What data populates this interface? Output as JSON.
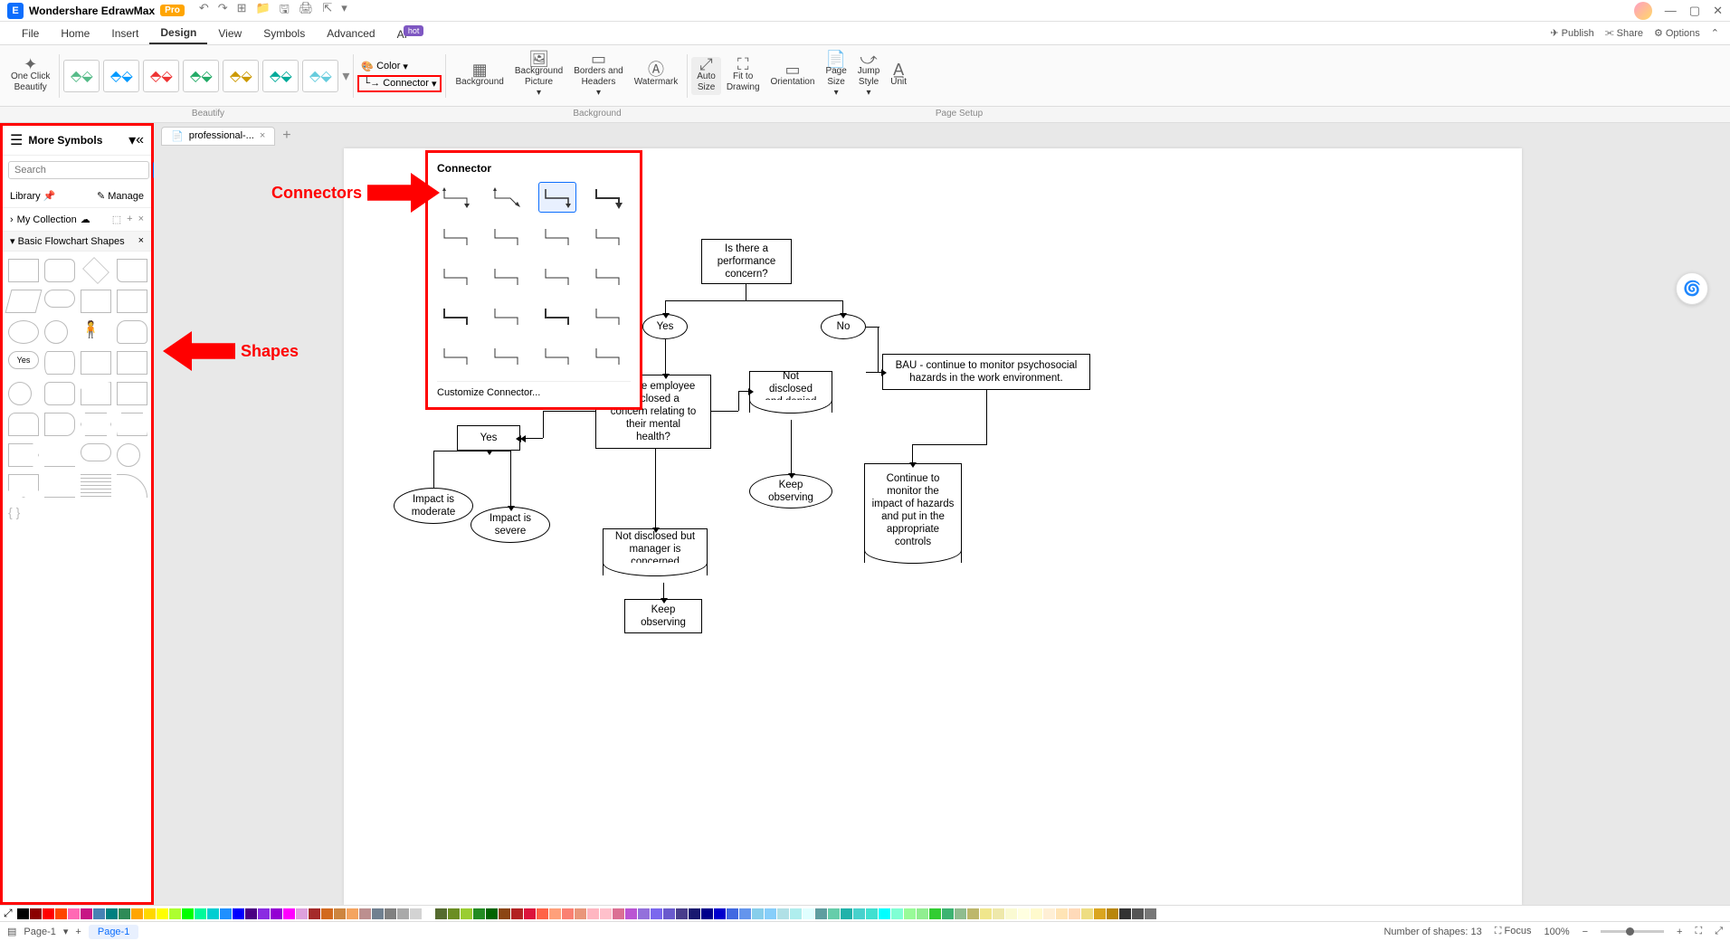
{
  "app": {
    "name": "Wondershare EdrawMax",
    "edition": "Pro"
  },
  "menu": {
    "items": [
      "File",
      "Home",
      "Insert",
      "Design",
      "View",
      "Symbols",
      "Advanced",
      "AI"
    ],
    "active": "Design",
    "ai_tag": "hot"
  },
  "top_actions": {
    "publish": "Publish",
    "share": "Share",
    "options": "Options"
  },
  "ribbon": {
    "one_click": "One Click\nBeautify",
    "color_label": "Color",
    "connector_label": "Connector",
    "background": "Background",
    "bg_picture": "Background\nPicture",
    "borders": "Borders and\nHeaders",
    "watermark": "Watermark",
    "auto_size": "Auto\nSize",
    "fit": "Fit to\nDrawing",
    "orientation": "Orientation",
    "page_size": "Page\nSize",
    "jump": "Jump\nStyle",
    "unit": "Unit",
    "sections": {
      "beautify": "Beautify",
      "background_sec": "Background",
      "page_setup": "Page Setup"
    }
  },
  "doc_tab": {
    "name": "professional-...",
    "add": "+"
  },
  "sidebar": {
    "title": "More Symbols",
    "search_placeholder": "Search",
    "search_btn": "Search",
    "library": "Library",
    "manage": "Manage",
    "collection": "My Collection",
    "shapes_head": "Basic Flowchart Shapes"
  },
  "connector_popup": {
    "title": "Connector",
    "customize": "Customize Connector..."
  },
  "annotations": {
    "connectors": "Connectors",
    "shapes": "Shapes"
  },
  "flowchart": {
    "n1": "Is there a\nperformance\nconcern?",
    "n2_yes": "Yes",
    "n2_no": "No",
    "n3": "Has the employee\ndisclosed a\nconcern relating to\ntheir mental\nhealth?",
    "n4": "Not\ndisclosed\nand denied",
    "n5": "BAU - continue to monitor psychosocial\nhazards in the work environment.",
    "n6_yes": "Yes",
    "n7": "Keep\nobserving",
    "n8": "Continue to\nmonitor the\nimpact of hazards\nand put in the\nappropriate\ncontrols",
    "n9": "Impact is\nmoderate",
    "n10": "Impact is\nsevere",
    "n11": "Not disclosed but\nmanager is\nconcerned",
    "n12": "Keep\nobserving"
  },
  "chart_data": {
    "type": "table",
    "description": "Flowchart: performance-concern decision tree",
    "nodes": [
      {
        "id": "n1",
        "type": "process",
        "text": "Is there a performance concern?"
      },
      {
        "id": "yes1",
        "type": "terminator",
        "text": "Yes"
      },
      {
        "id": "no1",
        "type": "terminator",
        "text": "No"
      },
      {
        "id": "n3",
        "type": "process",
        "text": "Has the employee disclosed a concern relating to their mental health?"
      },
      {
        "id": "n4",
        "type": "document",
        "text": "Not disclosed and denied"
      },
      {
        "id": "n5",
        "type": "process",
        "text": "BAU - continue to monitor psychosocial hazards in the work environment."
      },
      {
        "id": "yes2",
        "type": "process",
        "text": "Yes"
      },
      {
        "id": "n7",
        "type": "terminator",
        "text": "Keep observing"
      },
      {
        "id": "n8",
        "type": "document",
        "text": "Continue to monitor the impact of hazards and put in the appropriate controls"
      },
      {
        "id": "n9",
        "type": "terminator",
        "text": "Impact is moderate"
      },
      {
        "id": "n10",
        "type": "terminator",
        "text": "Impact is severe"
      },
      {
        "id": "n11",
        "type": "document",
        "text": "Not disclosed but manager is concerned"
      },
      {
        "id": "n12",
        "type": "process",
        "text": "Keep observing"
      }
    ],
    "edges": [
      {
        "from": "n1",
        "to": "yes1"
      },
      {
        "from": "n1",
        "to": "no1"
      },
      {
        "from": "yes1",
        "to": "n3"
      },
      {
        "from": "no1",
        "to": "n5"
      },
      {
        "from": "n3",
        "to": "n4"
      },
      {
        "from": "n3",
        "to": "yes2"
      },
      {
        "from": "n4",
        "to": "n7"
      },
      {
        "from": "n5",
        "to": "n8"
      },
      {
        "from": "yes2",
        "to": "n9"
      },
      {
        "from": "yes2",
        "to": "n10"
      },
      {
        "from": "n3",
        "to": "n11"
      },
      {
        "from": "n11",
        "to": "n12"
      }
    ]
  },
  "colors": [
    "#000000",
    "#8b0000",
    "#ff0000",
    "#ff4500",
    "#ff69b4",
    "#c71585",
    "#4682b4",
    "#008080",
    "#2e8b57",
    "#ffa500",
    "#ffd700",
    "#ffff00",
    "#adff2f",
    "#00ff00",
    "#00fa9a",
    "#00ced1",
    "#1e90ff",
    "#0000ff",
    "#4b0082",
    "#8a2be2",
    "#9400d3",
    "#ff00ff",
    "#dda0dd",
    "#a52a2a",
    "#d2691e",
    "#cd853f",
    "#f4a460",
    "#bc8f8f",
    "#708090",
    "#808080",
    "#a9a9a9",
    "#d3d3d3",
    "#ffffff",
    "#556b2f",
    "#6b8e23",
    "#9acd32",
    "#228b22",
    "#006400",
    "#8b4513",
    "#b22222",
    "#dc143c",
    "#ff6347",
    "#ffa07a",
    "#fa8072",
    "#e9967a",
    "#ffb6c1",
    "#ffc0cb",
    "#db7093",
    "#ba55d3",
    "#9370db",
    "#7b68ee",
    "#6a5acd",
    "#483d8b",
    "#191970",
    "#00008b",
    "#0000cd",
    "#4169e1",
    "#6495ed",
    "#87ceeb",
    "#87cefa",
    "#b0e0e6",
    "#afeeee",
    "#e0ffff",
    "#5f9ea0",
    "#66cdaa",
    "#20b2aa",
    "#48d1cc",
    "#40e0d0",
    "#00ffff",
    "#7fffd4",
    "#98fb98",
    "#90ee90",
    "#32cd32",
    "#3cb371",
    "#8fbc8f",
    "#bdb76b",
    "#f0e68c",
    "#eee8aa",
    "#fafad2",
    "#ffffe0",
    "#fffacd",
    "#ffefd5",
    "#ffe4b5",
    "#ffdab9",
    "#eedd82",
    "#daa520",
    "#b8860b",
    "#333333",
    "#555555",
    "#777777"
  ],
  "status": {
    "page_sel": "Page-1",
    "page_tab": "Page-1",
    "shape_count_label": "Number of shapes:",
    "shape_count": "13",
    "focus": "Focus",
    "zoom": "100%"
  }
}
